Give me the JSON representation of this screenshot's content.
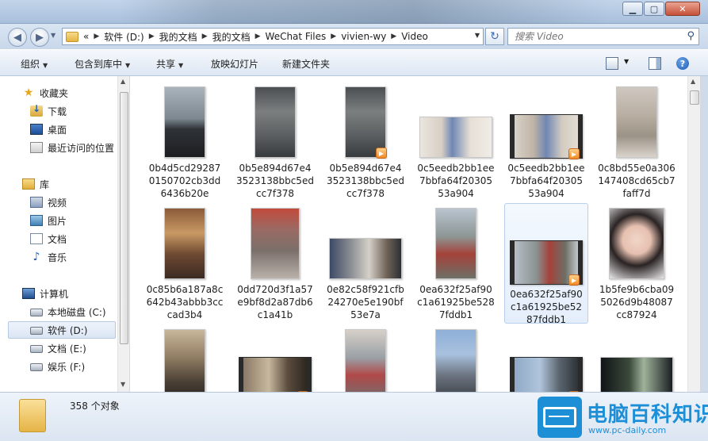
{
  "window": {
    "minimize_glyph": "▁",
    "maximize_glyph": "▢",
    "close_glyph": "✕"
  },
  "address": {
    "overflow": "«",
    "crumbs": [
      "软件 (D:)",
      "我的文档",
      "我的文档",
      "WeChat Files",
      "vivien-wy",
      "Video"
    ],
    "search_placeholder": "搜索 Video"
  },
  "toolbar": {
    "organize": "组织",
    "include_in_library": "包含到库中",
    "share": "共享",
    "slideshow": "放映幻灯片",
    "new_folder": "新建文件夹"
  },
  "nav": {
    "favorites": "收藏夹",
    "downloads": "下载",
    "desktop": "桌面",
    "recent": "最近访问的位置",
    "libraries": "库",
    "videos": "视频",
    "pictures": "图片",
    "documents": "文档",
    "music": "音乐",
    "computer": "计算机",
    "drive_c": "本地磁盘 (C:)",
    "drive_d": "软件 (D:)",
    "drive_e": "文档 (E:)",
    "drive_f": "娱乐 (F:)"
  },
  "files": [
    {
      "name": "0b4d5cd292870150702cb3dd6436b20e"
    },
    {
      "name": "0b5e894d67e43523138bbc5edcc7f378"
    },
    {
      "name": "0b5e894d67e43523138bbc5edcc7f378"
    },
    {
      "name": "0c5eedb2bb1ee7bbfa64f2030553a904"
    },
    {
      "name": "0c5eedb2bb1ee7bbfa64f2030553a904"
    },
    {
      "name": "0c8bd55e0a306147408cd65cb7faff7d"
    },
    {
      "name": "0c85b6a187a8c642b43abbb3cccad3b4"
    },
    {
      "name": "0dd720d3f1a57e9bf8d2a87db6c1a41b"
    },
    {
      "name": "0e82c58f921cfb24270e5e190bf53e7a"
    },
    {
      "name": "0ea632f25af90c1a61925be5287fddb1"
    },
    {
      "name": "0ea632f25af90c1a61925be5287fddb1"
    },
    {
      "name": "1b5fe9b6cba095026d9b48087cc87924"
    }
  ],
  "status": {
    "count": "358 个对象"
  },
  "watermark": {
    "title": "电脑百科知识",
    "url": "www.pc-daily.com"
  }
}
